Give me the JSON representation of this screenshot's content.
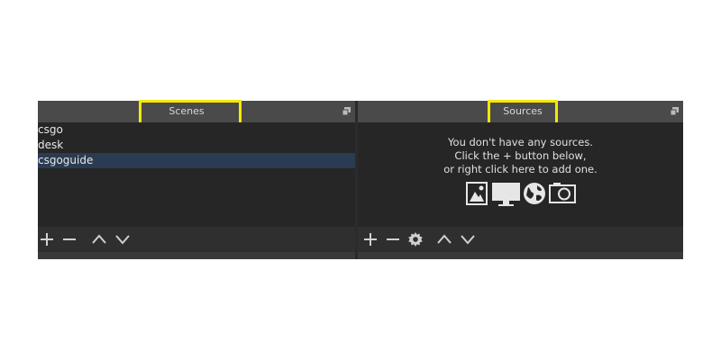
{
  "scenes": {
    "title": "Scenes",
    "items": [
      {
        "label": "csgo",
        "selected": false
      },
      {
        "label": "desk",
        "selected": false
      },
      {
        "label": "csgoguide",
        "selected": true
      }
    ],
    "toolbar": [
      "add-icon",
      "remove-icon",
      "move-up-icon",
      "move-down-icon"
    ]
  },
  "sources": {
    "title": "Sources",
    "empty_message": [
      "You don't have any sources.",
      "Click the + button below,",
      "or right click here to add one."
    ],
    "type_icons": [
      "image-icon",
      "display-capture-icon",
      "browser-globe-icon",
      "camera-icon"
    ],
    "toolbar": [
      "add-icon",
      "remove-icon",
      "gear-icon",
      "move-up-icon",
      "move-down-icon"
    ]
  },
  "colors": {
    "highlight": "#f5e800",
    "selected_row": "#2a3c52",
    "panel_bg": "#262626",
    "header_bg": "#4a4a4a"
  }
}
